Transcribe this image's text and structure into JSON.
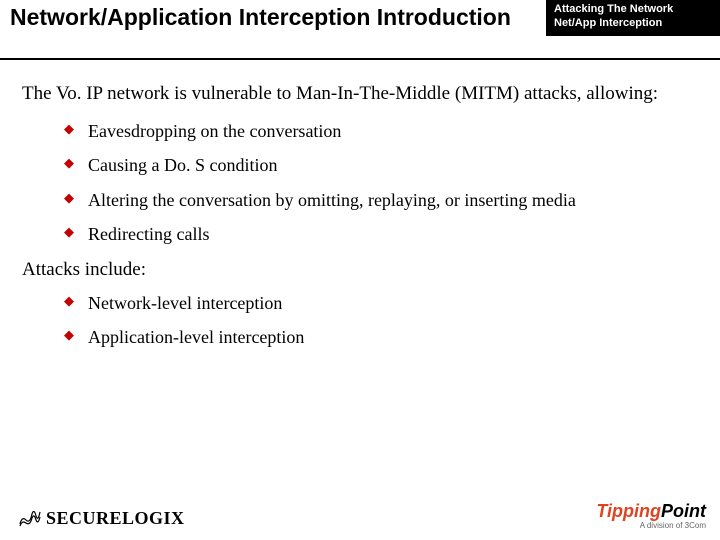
{
  "header": {
    "title": "Network/Application Interception Introduction",
    "tab_line1": "Attacking The Network",
    "tab_line2": "Net/App Interception"
  },
  "content": {
    "intro": "The Vo. IP network is vulnerable to Man-In-The-Middle (MITM) attacks, allowing:",
    "bullets1": [
      "Eavesdropping on the conversation",
      "Causing a Do. S condition",
      "Altering the conversation by omitting, replaying, or inserting media",
      "Redirecting calls"
    ],
    "intro2": "Attacks include:",
    "bullets2": [
      "Network-level interception",
      "Application-level interception"
    ]
  },
  "footer": {
    "left_brand": "SECURELOGIX",
    "right_brand_a": "Tipping",
    "right_brand_b": "Point",
    "right_sub": "A division of 3Com"
  }
}
